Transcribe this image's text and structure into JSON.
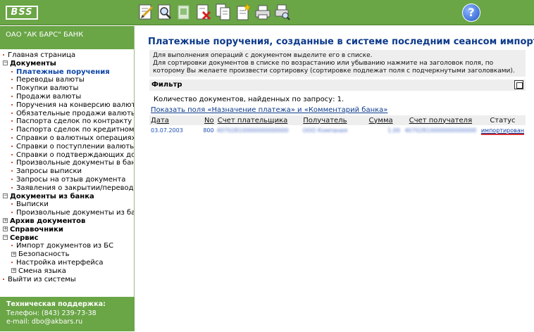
{
  "app": {
    "logo_text": "BSS"
  },
  "toolbar": {
    "buttons": [
      {
        "name": "edit-document-icon"
      },
      {
        "name": "view-document-icon"
      },
      {
        "name": "sign-document-icon"
      },
      {
        "name": "delete-document-icon"
      },
      {
        "name": "copy-document-icon"
      },
      {
        "name": "new-document-icon"
      },
      {
        "name": "print-icon"
      },
      {
        "name": "print-preview-icon"
      }
    ],
    "help_label": "?"
  },
  "sidebar": {
    "bank_name": "ОАО \"АК БАРС\" БАНК",
    "items": [
      {
        "label": "Главная страница",
        "level": 0,
        "marker": "dot"
      },
      {
        "label": "Документы",
        "level": 0,
        "marker": "minus",
        "section": true
      },
      {
        "label": "Платежные поручения",
        "level": 1,
        "marker": "dot",
        "active": true
      },
      {
        "label": "Переводы валюты",
        "level": 1,
        "marker": "dot"
      },
      {
        "label": "Покупки валюты",
        "level": 1,
        "marker": "dot"
      },
      {
        "label": "Продажи валюты",
        "level": 1,
        "marker": "dot"
      },
      {
        "label": "Поручения на конверсию валют",
        "level": 1,
        "marker": "dot"
      },
      {
        "label": "Обязательные продажи валюты",
        "level": 1,
        "marker": "dot"
      },
      {
        "label": "Паспорта сделок по контракту",
        "level": 1,
        "marker": "dot"
      },
      {
        "label": "Паспорта сделок по кредитному дого",
        "level": 1,
        "marker": "dot"
      },
      {
        "label": "Справки о валютных операциях",
        "level": 1,
        "marker": "dot"
      },
      {
        "label": "Справки о поступлении валюты РФ",
        "level": 1,
        "marker": "dot"
      },
      {
        "label": "Справки о подтверждающих докумен",
        "level": 1,
        "marker": "dot"
      },
      {
        "label": "Произвольные документы в банк",
        "level": 1,
        "marker": "dot"
      },
      {
        "label": "Запросы выписки",
        "level": 1,
        "marker": "dot"
      },
      {
        "label": "Запросы на отзыв документа",
        "level": 1,
        "marker": "dot"
      },
      {
        "label": "Заявления о закрытии/переводе пас",
        "level": 1,
        "marker": "dot"
      },
      {
        "label": "Документы из банка",
        "level": 0,
        "marker": "minus",
        "section": true
      },
      {
        "label": "Выписки",
        "level": 1,
        "marker": "dot"
      },
      {
        "label": "Произвольные документы из банка",
        "level": 1,
        "marker": "dot"
      },
      {
        "label": "Архив документов",
        "level": 0,
        "marker": "plus",
        "section": true
      },
      {
        "label": "Справочники",
        "level": 0,
        "marker": "plus",
        "section": true
      },
      {
        "label": "Сервис",
        "level": 0,
        "marker": "minus",
        "section": true
      },
      {
        "label": "Импорт документов из БС",
        "level": 1,
        "marker": "dot"
      },
      {
        "label": "Безопасность",
        "level": 1,
        "marker": "plus"
      },
      {
        "label": "Настройка интерфейса",
        "level": 1,
        "marker": "dot"
      },
      {
        "label": "Смена языка",
        "level": 1,
        "marker": "plus"
      },
      {
        "label": "Выйти из системы",
        "level": 0,
        "marker": "dot"
      }
    ],
    "support": {
      "title": "Техническая поддержка:",
      "phone": "Телефон: (843) 239-73-38",
      "email": "e-mail: dbo@akbars.ru"
    }
  },
  "main": {
    "title": "Платежные поручения, созданные в системе последним сеансом импорта",
    "info_line1": "Для выполнения операций с документом выделите его в списке.",
    "info_line2": "Для сортировки документов в списке по возрастанию или убыванию нажмите на заголовок поля, по которому Вы желаете произвести сортировку (сортировке подлежат поля с подчеркнутыми заголовками).",
    "filter_label": "Фильтр",
    "count_text": "Количество  документов, найденных по запросу:  1.",
    "show_fields_link": "Показать поля «Назначение платежа» и «Комментарий банка»",
    "columns": [
      "Дата",
      "No",
      "Счет плательщика",
      "Получатель",
      "Сумма",
      "Счет получателя",
      "Статус"
    ],
    "rows": [
      {
        "date": "03.07.2003",
        "no": "800",
        "payer_account": "40702810000000000000",
        "recipient": "ООО Компания",
        "amount": "1,00",
        "recipient_account": "40702810000000000000",
        "status": "импортирован"
      }
    ]
  },
  "colors": {
    "brand_green": "#6aa546",
    "title_blue": "#0d3a8c",
    "status_underline": "#d93030"
  }
}
